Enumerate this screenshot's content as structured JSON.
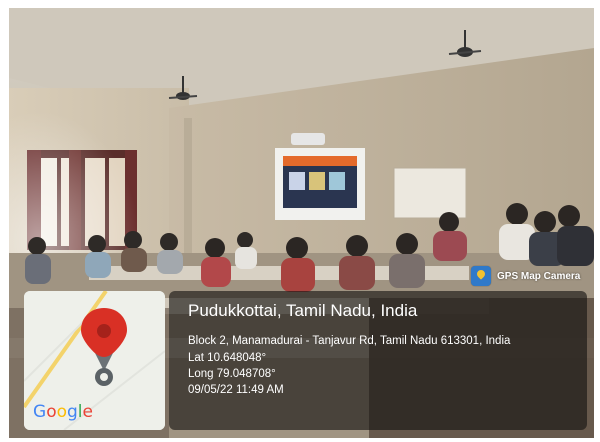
{
  "watermark": {
    "app_name": "GPS Map Camera",
    "icon": "gps-map-camera-icon"
  },
  "map": {
    "logo_letters": [
      {
        "ch": "G",
        "color": "#4285f4"
      },
      {
        "ch": "o",
        "color": "#ea4335"
      },
      {
        "ch": "o",
        "color": "#fbbc05"
      },
      {
        "ch": "g",
        "color": "#4285f4"
      },
      {
        "ch": "l",
        "color": "#34a853"
      },
      {
        "ch": "e",
        "color": "#ea4335"
      }
    ],
    "pin_icon": "map-pin-icon",
    "pin_color": "#d93025"
  },
  "location": {
    "title": "Pudukkottai, Tamil Nadu, India",
    "address": "Block 2, Manamadurai - Tanjavur Rd, Tamil Nadu 613301, India",
    "latitude": "Lat 10.648048°",
    "longitude": "Long 79.048708°",
    "datetime": "09/05/22 11:49 AM"
  }
}
